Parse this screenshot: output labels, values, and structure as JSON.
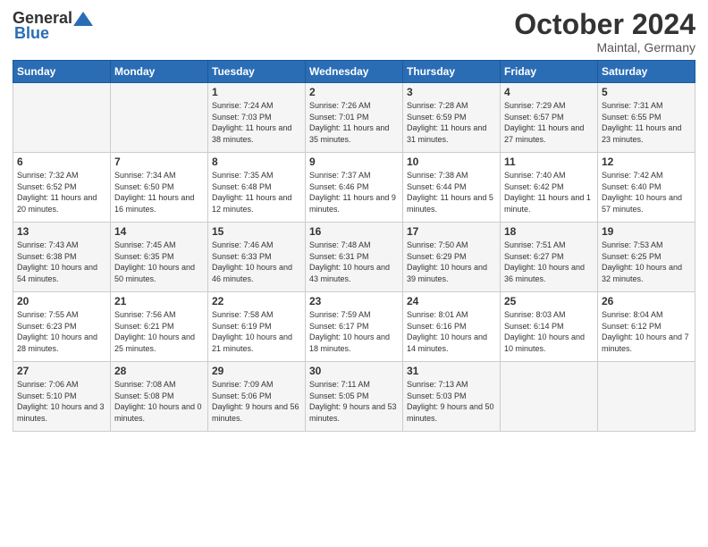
{
  "header": {
    "logo_general": "General",
    "logo_blue": "Blue",
    "month_title": "October 2024",
    "location": "Maintal, Germany"
  },
  "weekdays": [
    "Sunday",
    "Monday",
    "Tuesday",
    "Wednesday",
    "Thursday",
    "Friday",
    "Saturday"
  ],
  "weeks": [
    [
      {
        "day": "",
        "info": ""
      },
      {
        "day": "",
        "info": ""
      },
      {
        "day": "1",
        "info": "Sunrise: 7:24 AM\nSunset: 7:03 PM\nDaylight: 11 hours and 38 minutes."
      },
      {
        "day": "2",
        "info": "Sunrise: 7:26 AM\nSunset: 7:01 PM\nDaylight: 11 hours and 35 minutes."
      },
      {
        "day": "3",
        "info": "Sunrise: 7:28 AM\nSunset: 6:59 PM\nDaylight: 11 hours and 31 minutes."
      },
      {
        "day": "4",
        "info": "Sunrise: 7:29 AM\nSunset: 6:57 PM\nDaylight: 11 hours and 27 minutes."
      },
      {
        "day": "5",
        "info": "Sunrise: 7:31 AM\nSunset: 6:55 PM\nDaylight: 11 hours and 23 minutes."
      }
    ],
    [
      {
        "day": "6",
        "info": "Sunrise: 7:32 AM\nSunset: 6:52 PM\nDaylight: 11 hours and 20 minutes."
      },
      {
        "day": "7",
        "info": "Sunrise: 7:34 AM\nSunset: 6:50 PM\nDaylight: 11 hours and 16 minutes."
      },
      {
        "day": "8",
        "info": "Sunrise: 7:35 AM\nSunset: 6:48 PM\nDaylight: 11 hours and 12 minutes."
      },
      {
        "day": "9",
        "info": "Sunrise: 7:37 AM\nSunset: 6:46 PM\nDaylight: 11 hours and 9 minutes."
      },
      {
        "day": "10",
        "info": "Sunrise: 7:38 AM\nSunset: 6:44 PM\nDaylight: 11 hours and 5 minutes."
      },
      {
        "day": "11",
        "info": "Sunrise: 7:40 AM\nSunset: 6:42 PM\nDaylight: 11 hours and 1 minute."
      },
      {
        "day": "12",
        "info": "Sunrise: 7:42 AM\nSunset: 6:40 PM\nDaylight: 10 hours and 57 minutes."
      }
    ],
    [
      {
        "day": "13",
        "info": "Sunrise: 7:43 AM\nSunset: 6:38 PM\nDaylight: 10 hours and 54 minutes."
      },
      {
        "day": "14",
        "info": "Sunrise: 7:45 AM\nSunset: 6:35 PM\nDaylight: 10 hours and 50 minutes."
      },
      {
        "day": "15",
        "info": "Sunrise: 7:46 AM\nSunset: 6:33 PM\nDaylight: 10 hours and 46 minutes."
      },
      {
        "day": "16",
        "info": "Sunrise: 7:48 AM\nSunset: 6:31 PM\nDaylight: 10 hours and 43 minutes."
      },
      {
        "day": "17",
        "info": "Sunrise: 7:50 AM\nSunset: 6:29 PM\nDaylight: 10 hours and 39 minutes."
      },
      {
        "day": "18",
        "info": "Sunrise: 7:51 AM\nSunset: 6:27 PM\nDaylight: 10 hours and 36 minutes."
      },
      {
        "day": "19",
        "info": "Sunrise: 7:53 AM\nSunset: 6:25 PM\nDaylight: 10 hours and 32 minutes."
      }
    ],
    [
      {
        "day": "20",
        "info": "Sunrise: 7:55 AM\nSunset: 6:23 PM\nDaylight: 10 hours and 28 minutes."
      },
      {
        "day": "21",
        "info": "Sunrise: 7:56 AM\nSunset: 6:21 PM\nDaylight: 10 hours and 25 minutes."
      },
      {
        "day": "22",
        "info": "Sunrise: 7:58 AM\nSunset: 6:19 PM\nDaylight: 10 hours and 21 minutes."
      },
      {
        "day": "23",
        "info": "Sunrise: 7:59 AM\nSunset: 6:17 PM\nDaylight: 10 hours and 18 minutes."
      },
      {
        "day": "24",
        "info": "Sunrise: 8:01 AM\nSunset: 6:16 PM\nDaylight: 10 hours and 14 minutes."
      },
      {
        "day": "25",
        "info": "Sunrise: 8:03 AM\nSunset: 6:14 PM\nDaylight: 10 hours and 10 minutes."
      },
      {
        "day": "26",
        "info": "Sunrise: 8:04 AM\nSunset: 6:12 PM\nDaylight: 10 hours and 7 minutes."
      }
    ],
    [
      {
        "day": "27",
        "info": "Sunrise: 7:06 AM\nSunset: 5:10 PM\nDaylight: 10 hours and 3 minutes."
      },
      {
        "day": "28",
        "info": "Sunrise: 7:08 AM\nSunset: 5:08 PM\nDaylight: 10 hours and 0 minutes."
      },
      {
        "day": "29",
        "info": "Sunrise: 7:09 AM\nSunset: 5:06 PM\nDaylight: 9 hours and 56 minutes."
      },
      {
        "day": "30",
        "info": "Sunrise: 7:11 AM\nSunset: 5:05 PM\nDaylight: 9 hours and 53 minutes."
      },
      {
        "day": "31",
        "info": "Sunrise: 7:13 AM\nSunset: 5:03 PM\nDaylight: 9 hours and 50 minutes."
      },
      {
        "day": "",
        "info": ""
      },
      {
        "day": "",
        "info": ""
      }
    ]
  ]
}
